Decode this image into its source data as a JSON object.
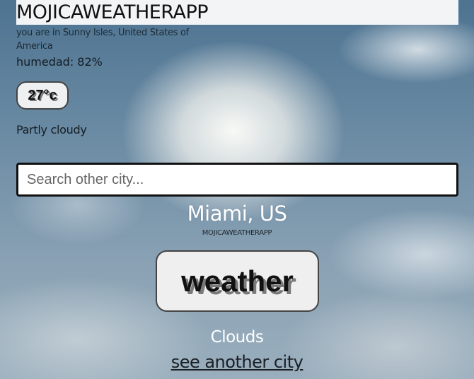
{
  "header": {
    "title": "MOJICAWEATHERAPP"
  },
  "location": {
    "text": "you are in Sunny Isles, United States of America"
  },
  "humidity": {
    "text": "humedad: 82%"
  },
  "temperature": {
    "text": "27°c"
  },
  "current_condition": {
    "text": "Partly cloudy"
  },
  "search": {
    "placeholder": "Search other city...",
    "value": ""
  },
  "result": {
    "city": "Miami, US",
    "subtitle": "MOJICAWEATHERAPP",
    "button_label": "weather",
    "condition": "Clouds",
    "link_label": "see another city"
  }
}
